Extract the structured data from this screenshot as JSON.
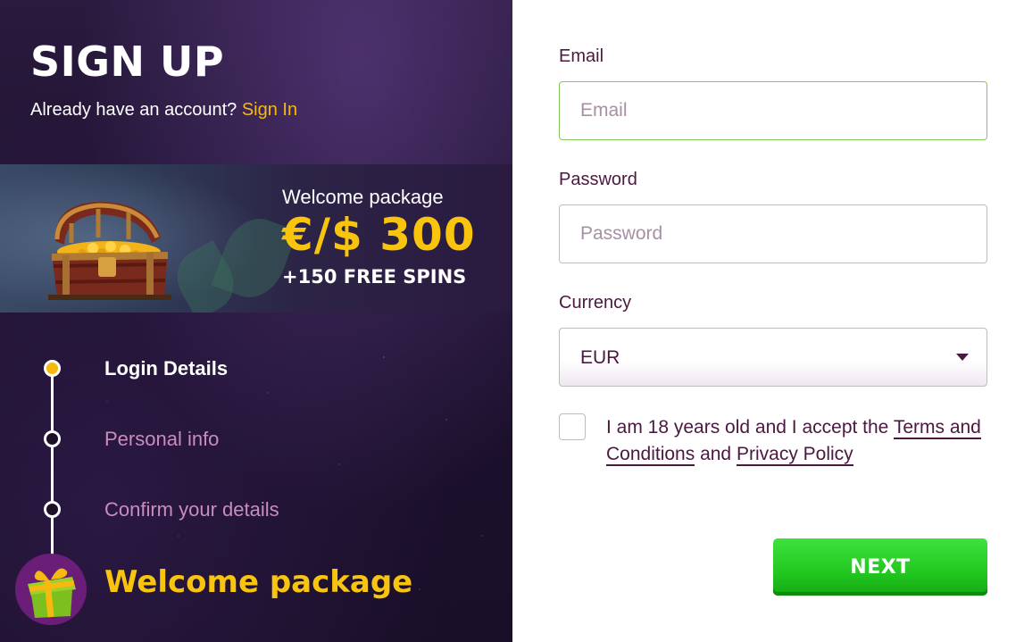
{
  "header": {
    "title": "SIGN UP",
    "have_account": "Already have an account?",
    "signin_link": "Sign In"
  },
  "banner": {
    "label": "Welcome package",
    "amount": "€/$ 300",
    "spins": "+150 FREE SPINS",
    "image_icon": "treasure-chest-icon"
  },
  "steps": [
    {
      "label": "Login Details",
      "active": true
    },
    {
      "label": "Personal info",
      "active": false
    },
    {
      "label": "Confirm your details",
      "active": false
    }
  ],
  "final_step": {
    "label": "Welcome package",
    "icon": "gift-icon"
  },
  "form": {
    "email_label": "Email",
    "email_placeholder": "Email",
    "email_value": "",
    "password_label": "Password",
    "password_placeholder": "Password",
    "password_value": "",
    "currency_label": "Currency",
    "currency_value": "EUR",
    "terms_prefix": "I am 18 years old and I accept the",
    "terms_link": "Terms and Conditions",
    "terms_and": "and",
    "privacy_link": "Privacy Policy",
    "terms_checked": false,
    "next_label": "NEXT"
  },
  "colors": {
    "accent_yellow": "#f5b90f",
    "text_purple": "#4a1940",
    "inactive_step": "#c88cc0",
    "next_green": "#22c71f",
    "focus_border": "#86c95a"
  }
}
